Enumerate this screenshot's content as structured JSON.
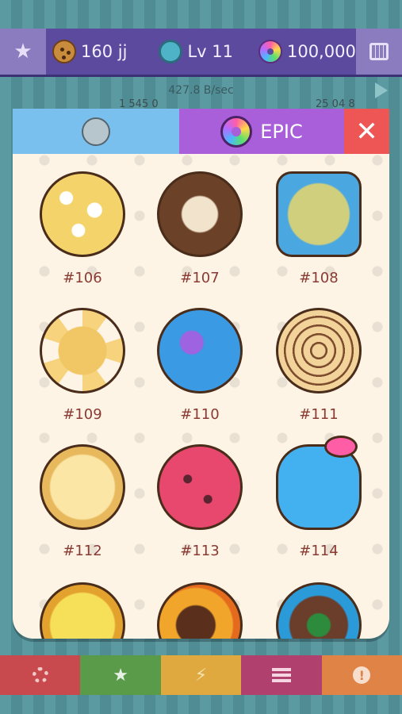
{
  "topbar": {
    "cookies": "160 jj",
    "level": "Lv 11",
    "donuts": "100,000"
  },
  "rate": "427.8 B/sec",
  "sub_left": "1 545 0",
  "sub_right": "25 04 8",
  "modal": {
    "tab_epic_label": "EPIC",
    "close_label": "✕"
  },
  "items": [
    {
      "label": "#106"
    },
    {
      "label": "#107"
    },
    {
      "label": "#108"
    },
    {
      "label": "#109"
    },
    {
      "label": "#110"
    },
    {
      "label": "#111"
    },
    {
      "label": "#112"
    },
    {
      "label": "#113"
    },
    {
      "label": "#114"
    }
  ],
  "bottom": {
    "star": "★",
    "bolt": "⚡",
    "info": "!"
  }
}
